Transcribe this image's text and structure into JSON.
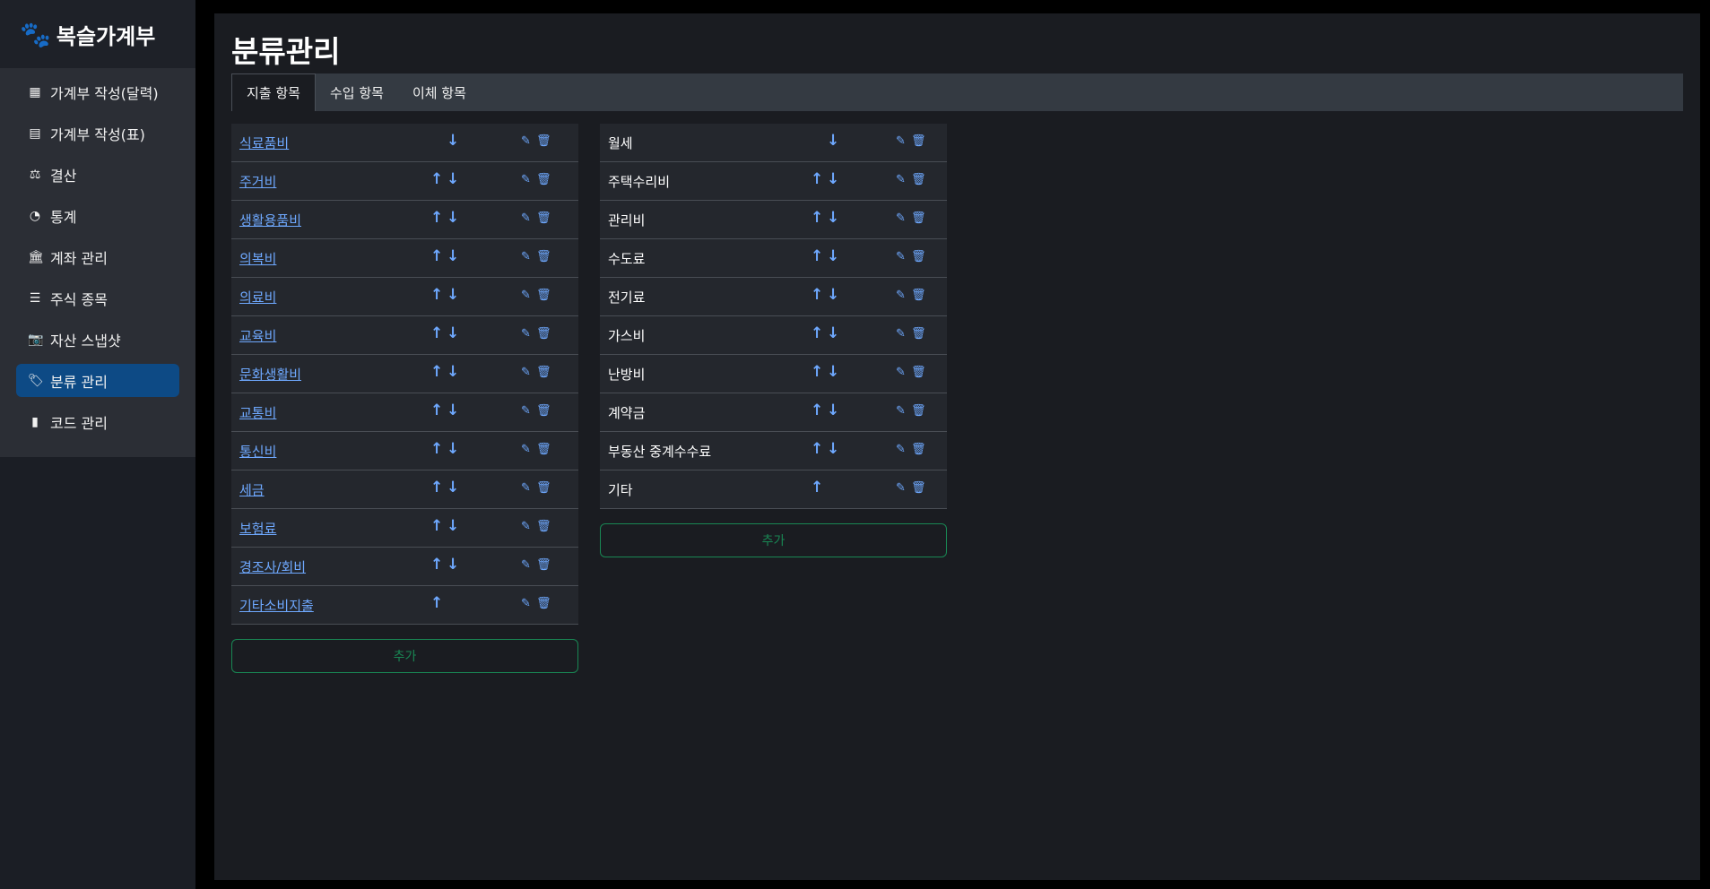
{
  "app": {
    "name": "복슬가계부"
  },
  "sidebar": {
    "items": [
      {
        "label": "가계부 작성(달력)",
        "icon": "calendar-icon"
      },
      {
        "label": "가계부 작성(표)",
        "icon": "table-icon"
      },
      {
        "label": "결산",
        "icon": "scale-icon"
      },
      {
        "label": "통계",
        "icon": "pie-chart-icon"
      },
      {
        "label": "계좌 관리",
        "icon": "bank-icon"
      },
      {
        "label": "주식 종목",
        "icon": "list-icon"
      },
      {
        "label": "자산 스냅샷",
        "icon": "camera-icon"
      },
      {
        "label": "분류 관리",
        "icon": "tags-icon",
        "active": true
      },
      {
        "label": "코드 관리",
        "icon": "book-icon"
      }
    ]
  },
  "page": {
    "title": "분류관리"
  },
  "tabs": [
    {
      "label": "지출 항목",
      "active": true
    },
    {
      "label": "수입 항목"
    },
    {
      "label": "이체 항목"
    }
  ],
  "expense_list": [
    {
      "name": "식료품비",
      "up": false,
      "down": true
    },
    {
      "name": "주거비",
      "up": true,
      "down": true
    },
    {
      "name": "생활용품비",
      "up": true,
      "down": true
    },
    {
      "name": "의복비",
      "up": true,
      "down": true
    },
    {
      "name": "의료비",
      "up": true,
      "down": true
    },
    {
      "name": "교육비",
      "up": true,
      "down": true
    },
    {
      "name": "문화생활비",
      "up": true,
      "down": true
    },
    {
      "name": "교통비",
      "up": true,
      "down": true
    },
    {
      "name": "통신비",
      "up": true,
      "down": true
    },
    {
      "name": "세금",
      "up": true,
      "down": true
    },
    {
      "name": "보험료",
      "up": true,
      "down": true
    },
    {
      "name": "경조사/회비",
      "up": true,
      "down": true
    },
    {
      "name": "기타소비지출",
      "up": true,
      "down": false
    }
  ],
  "sub_list": [
    {
      "name": "월세",
      "up": false,
      "down": true
    },
    {
      "name": "주택수리비",
      "up": true,
      "down": true
    },
    {
      "name": "관리비",
      "up": true,
      "down": true
    },
    {
      "name": "수도료",
      "up": true,
      "down": true
    },
    {
      "name": "전기료",
      "up": true,
      "down": true
    },
    {
      "name": "가스비",
      "up": true,
      "down": true
    },
    {
      "name": "난방비",
      "up": true,
      "down": true
    },
    {
      "name": "계약금",
      "up": true,
      "down": true
    },
    {
      "name": "부동산 중계수수료",
      "up": true,
      "down": true
    },
    {
      "name": "기타",
      "up": true,
      "down": false
    }
  ],
  "buttons": {
    "add_label": "추가"
  },
  "icons": {
    "up": "↑",
    "down": "↓",
    "edit": "✎",
    "delete": "🗑"
  },
  "colors": {
    "link": "#6ea8fe",
    "active_nav": "#0d4a85",
    "add_button": "#198754"
  }
}
